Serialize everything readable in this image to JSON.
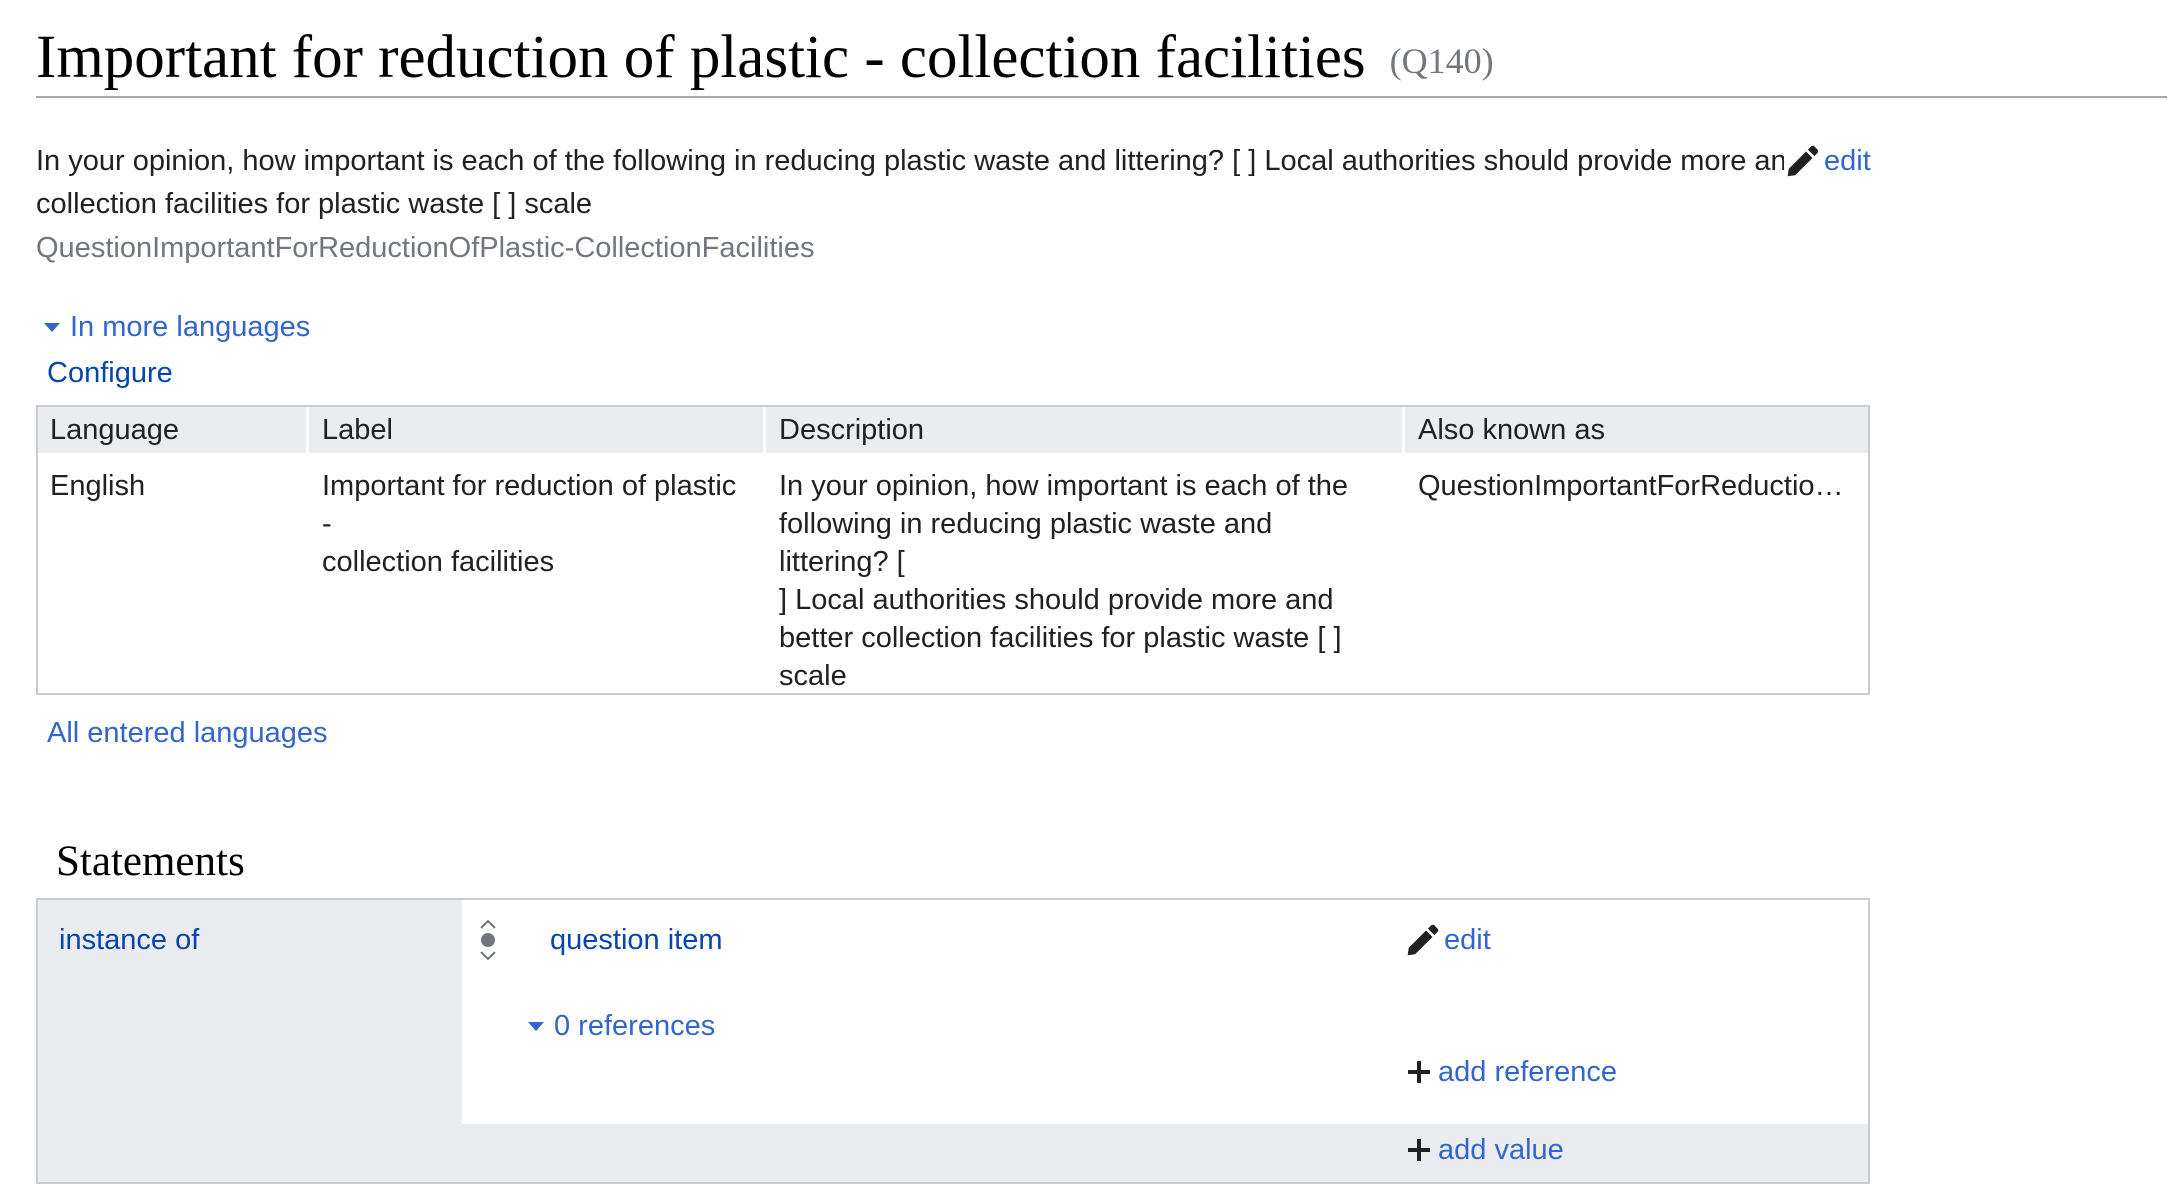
{
  "header": {
    "title": "Important for reduction of plastic - collection facilities",
    "qid": "(Q140)"
  },
  "description": {
    "line1": "In your opinion, how important is each of the following in reducing plastic waste and littering? [ ] Local authorities should provide more and better",
    "line2": "collection facilities for plastic waste [ ] scale",
    "alias": "QuestionImportantForReductionOfPlastic-CollectionFacilities",
    "edit_label": "edit",
    "edit_icon": "pencil-icon"
  },
  "languages": {
    "toggle_label": "In more languages",
    "configure_label": "Configure",
    "headers": [
      "Language",
      "Label",
      "Description",
      "Also known as"
    ],
    "rows": [
      {
        "language": "English",
        "label_lines": [
          "Important for reduction of plastic -",
          "collection facilities"
        ],
        "description_lines": [
          "In your opinion, how important is each of the",
          "following in reducing plastic waste and littering? [",
          "] Local authorities should provide more and",
          "better collection facilities for plastic waste [ ]",
          "scale"
        ],
        "also_known_as": "QuestionImportantForReductionOfPlastic-CollectionFacilities"
      }
    ],
    "all_languages_label": "All entered languages"
  },
  "statements": {
    "heading": "Statements",
    "items": [
      {
        "property": "instance of",
        "value": "question item",
        "edit_label": "edit",
        "references_label": "0 references",
        "add_reference_label": "add reference",
        "add_value_label": "add value"
      }
    ]
  },
  "colors": {
    "link": "#3366cc",
    "link_dark": "#0645ad",
    "text": "#202122",
    "muted": "#72777d",
    "border": "#c8ccd1",
    "header_bg": "#eaecf0"
  }
}
